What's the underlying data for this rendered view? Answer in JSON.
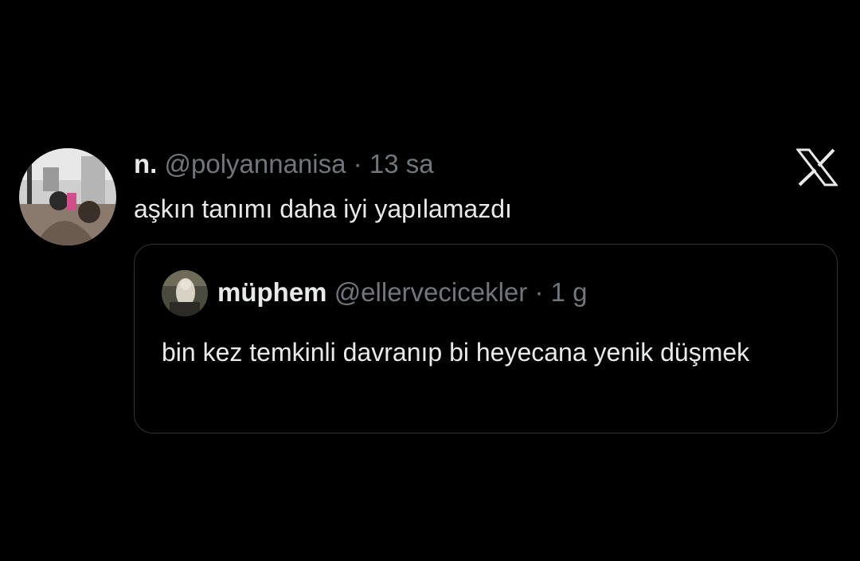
{
  "tweet": {
    "author": {
      "name": "n.",
      "handle": "@polyannanisa",
      "separator": "·",
      "time": "13 sa"
    },
    "text": "aşkın tanımı daha iyi yapılamazdı",
    "platform_icon": "x-logo-icon",
    "quoted": {
      "author": {
        "name": "müphem",
        "handle": "@ellervecicekler",
        "separator": "·",
        "time": "1 g"
      },
      "text": "bin kez temkinli davranıp bi heyecana yenik düşmek"
    }
  },
  "colors": {
    "background": "#000000",
    "primary_text": "#e7e9ea",
    "secondary_text": "#71767b",
    "quote_border": "#2f3336"
  }
}
